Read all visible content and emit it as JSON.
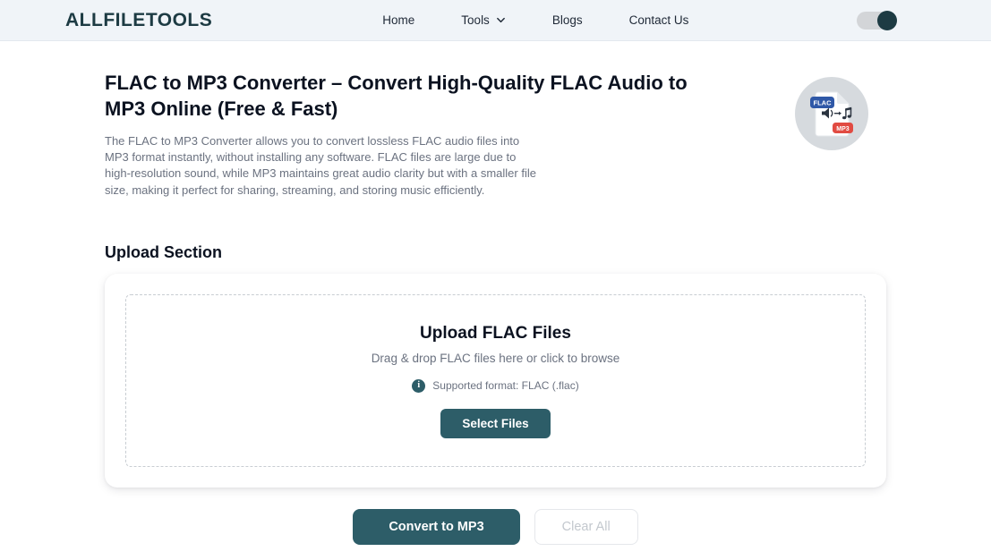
{
  "header": {
    "logo": "ALLFILETOOLS",
    "nav": [
      {
        "label": "Home"
      },
      {
        "label": "Tools",
        "has_dropdown": true
      },
      {
        "label": "Blogs"
      },
      {
        "label": "Contact Us"
      }
    ],
    "theme_toggle_state": "on"
  },
  "hero": {
    "title": "FLAC to MP3 Converter – Convert High-Quality FLAC Audio to MP3 Online (Free & Fast)",
    "description": "The FLAC to MP3 Converter allows you to convert lossless FLAC audio files into MP3 format instantly, without installing any software. FLAC files are large due to high-resolution sound, while MP3 maintains great audio clarity but with a smaller file size, making it perfect for sharing, streaming, and storing music efficiently.",
    "badge_icon": {
      "source_format": "FLAC",
      "target_format": "MP3"
    }
  },
  "upload": {
    "section_title": "Upload Section",
    "dropzone_title": "Upload FLAC Files",
    "dropzone_subtitle": "Drag & drop FLAC files here or click to browse",
    "supported_format": "Supported format: FLAC (.flac)",
    "info_glyph": "i",
    "select_button_label": "Select Files"
  },
  "actions": {
    "convert_button_label": "Convert to MP3",
    "clear_button_label": "Clear All"
  },
  "colors": {
    "accent_teal": "#2d5d68",
    "logo_dark_teal": "#1d3b43",
    "header_background": "#f0f4f8",
    "flac_badge_blue": "#2f58a7",
    "mp3_badge_red": "#e14b42",
    "muted_text": "#6b7280"
  }
}
